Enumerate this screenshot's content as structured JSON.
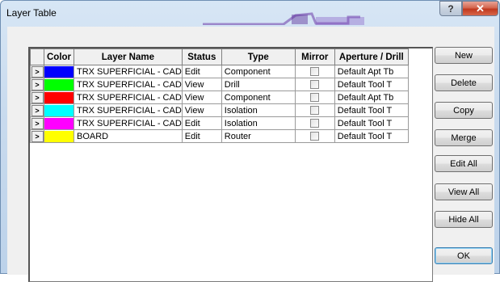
{
  "window": {
    "title": "Layer Table",
    "help_glyph": "?",
    "close_glyph": "✕"
  },
  "table": {
    "columns": [
      "",
      "Color",
      "Layer Name",
      "Status",
      "Type",
      "Mirror",
      "Aperture / Drill"
    ],
    "rows": [
      {
        "marker": ">",
        "color": "#0000ff",
        "name": "TRX SUPERFICIAL - CAD",
        "status": "Edit",
        "type": "Component",
        "mirror": false,
        "aperture": "Default Apt Tb"
      },
      {
        "marker": ">",
        "color": "#00ff00",
        "name": "TRX SUPERFICIAL - CAD",
        "status": "View",
        "type": "Drill",
        "mirror": false,
        "aperture": "Default Tool T"
      },
      {
        "marker": ">",
        "color": "#ff0000",
        "name": "TRX SUPERFICIAL - CAD",
        "status": "View",
        "type": "Component",
        "mirror": false,
        "aperture": "Default Apt Tb"
      },
      {
        "marker": ">",
        "color": "#00ffff",
        "name": "TRX SUPERFICIAL - CAD",
        "status": "View",
        "type": "Isolation",
        "mirror": false,
        "aperture": "Default Tool T"
      },
      {
        "marker": ">",
        "color": "#ff00ff",
        "name": "TRX SUPERFICIAL - CAD",
        "status": "Edit",
        "type": "Isolation",
        "mirror": false,
        "aperture": "Default Tool T"
      },
      {
        "marker": ">",
        "color": "#ffff00",
        "name": "BOARD",
        "status": "Edit",
        "type": "Router",
        "mirror": false,
        "aperture": "Default Tool T"
      }
    ]
  },
  "buttons": {
    "new": "New",
    "delete": "Delete",
    "copy": "Copy",
    "merge": "Merge",
    "edit_all": "Edit All",
    "view_all": "View All",
    "hide_all": "Hide All",
    "ok": "OK"
  }
}
